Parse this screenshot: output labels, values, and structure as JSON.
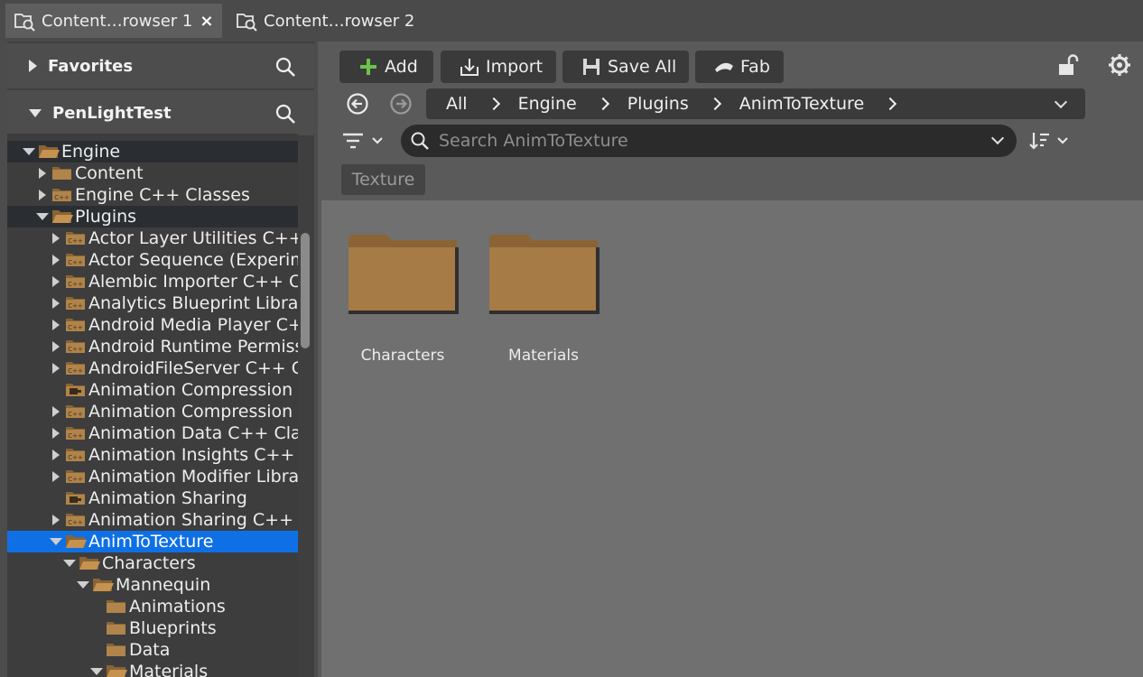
{
  "tabs": [
    {
      "label": "Content…rowser 1",
      "active": true,
      "close": "×"
    },
    {
      "label": "Content…rowser 2",
      "active": false
    }
  ],
  "sidebar": {
    "favorites_label": "Favorites",
    "project_label": "PenLightTest",
    "tree": [
      {
        "label": "Engine",
        "expander": "open",
        "icon": "folder-open",
        "style": "highlight"
      },
      {
        "label": "Content",
        "expander": "closed",
        "icon": "folder"
      },
      {
        "label": "Engine C++ Classes",
        "expander": "closed",
        "icon": "folder-cpp"
      },
      {
        "label": "Plugins",
        "expander": "open",
        "icon": "folder-open",
        "style": "highlight"
      },
      {
        "label": "Actor Layer Utilities C++ Classes",
        "expander": "closed",
        "icon": "folder-cpp"
      },
      {
        "label": "Actor Sequence (Experimental) C++ Classes",
        "expander": "closed",
        "icon": "folder-cpp"
      },
      {
        "label": "Alembic Importer C++ Classes",
        "expander": "closed",
        "icon": "folder-cpp"
      },
      {
        "label": "Analytics Blueprint Library C++ Classes",
        "expander": "closed",
        "icon": "folder-cpp"
      },
      {
        "label": "Android Media Player C++ Classes",
        "expander": "closed",
        "icon": "folder-cpp"
      },
      {
        "label": "Android Runtime Permission C++ Classes",
        "expander": "closed",
        "icon": "folder-cpp"
      },
      {
        "label": "AndroidFileServer C++ Classes",
        "expander": "closed",
        "icon": "folder-cpp"
      },
      {
        "label": "Animation Compression Library",
        "expander": "none",
        "icon": "folder-plugin"
      },
      {
        "label": "Animation Compression Library C++ Classes",
        "expander": "closed",
        "icon": "folder-cpp"
      },
      {
        "label": "Animation Data C++ Classes",
        "expander": "closed",
        "icon": "folder-cpp"
      },
      {
        "label": "Animation Insights C++ Classes",
        "expander": "closed",
        "icon": "folder-cpp"
      },
      {
        "label": "Animation Modifier Library C++ Classes",
        "expander": "closed",
        "icon": "folder-cpp"
      },
      {
        "label": "Animation Sharing",
        "expander": "none",
        "icon": "folder-plugin"
      },
      {
        "label": "Animation Sharing C++ Classes",
        "expander": "closed",
        "icon": "folder-cpp"
      },
      {
        "label": "AnimToTexture",
        "expander": "open",
        "icon": "folder-open",
        "style": "selected"
      },
      {
        "label": "Characters",
        "expander": "open",
        "icon": "folder-open"
      },
      {
        "label": "Mannequin",
        "expander": "open",
        "icon": "folder-open"
      },
      {
        "label": "Animations",
        "expander": "none",
        "icon": "folder"
      },
      {
        "label": "Blueprints",
        "expander": "none",
        "icon": "folder"
      },
      {
        "label": "Data",
        "expander": "none",
        "icon": "folder"
      },
      {
        "label": "Materials",
        "expander": "open",
        "icon": "folder-open"
      }
    ]
  },
  "toolbar": {
    "add_label": "Add",
    "import_label": "Import",
    "save_all_label": "Save All",
    "fab_label": "Fab"
  },
  "breadcrumb": [
    "All",
    "Engine",
    "Plugins",
    "AnimToTexture"
  ],
  "search": {
    "placeholder": "Search AnimToTexture"
  },
  "filter_chip": "Texture",
  "assets": [
    {
      "label": "Characters",
      "type": "folder"
    },
    {
      "label": "Materials",
      "type": "folder"
    }
  ],
  "colors": {
    "selection": "#0f70e6",
    "folder": "#a67b45",
    "add_icon": "#6cc24a"
  }
}
